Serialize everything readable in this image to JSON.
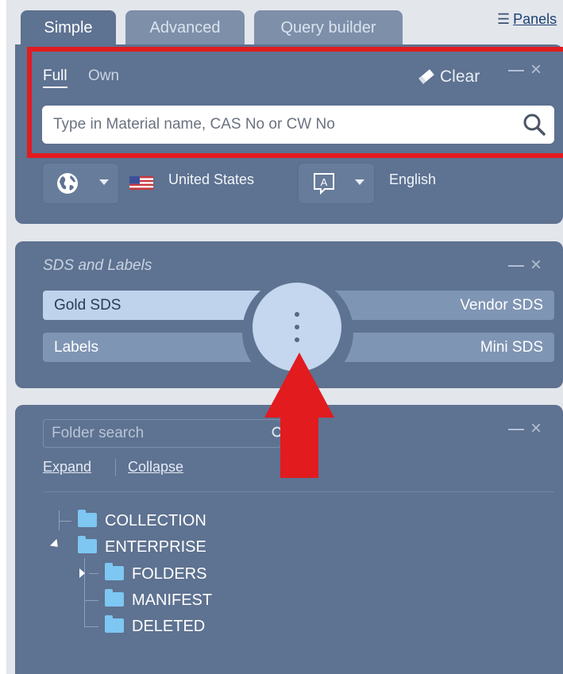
{
  "tabs": [
    {
      "label": "Simple",
      "active": true
    },
    {
      "label": "Advanced",
      "active": false
    },
    {
      "label": "Query builder",
      "active": false
    }
  ],
  "panels_link": {
    "label": "Panels"
  },
  "search_panel": {
    "modes": [
      {
        "label": "Full",
        "active": true
      },
      {
        "label": "Own",
        "active": false
      }
    ],
    "clear_label": "Clear",
    "search": {
      "placeholder": "Type in Material name, CAS No or CW No",
      "value": ""
    },
    "region": {
      "icon": "globe-icon",
      "country": "United States",
      "flag": "us-flag-icon"
    },
    "language": {
      "icon": "language-icon",
      "label": "English"
    }
  },
  "sds_panel": {
    "title": "SDS and Labels",
    "buttons": {
      "gold": "Gold SDS",
      "vendor": "Vendor SDS",
      "labels": "Labels",
      "mini": "Mini SDS"
    },
    "hub_icon": "more-vertical-icon"
  },
  "folder_panel": {
    "search_placeholder": "Folder search",
    "expand_label": "Expand",
    "collapse_label": "Collapse",
    "tree": [
      {
        "label": "COLLECTION",
        "level": 0
      },
      {
        "label": "ENTERPRISE",
        "level": 0,
        "expanded": true
      },
      {
        "label": "FOLDERS",
        "level": 1,
        "expanded": false
      },
      {
        "label": "MANIFEST",
        "level": 1
      },
      {
        "label": "DELETED",
        "level": 1
      }
    ]
  },
  "colors": {
    "panel": "#5e7291",
    "highlight": "#e21b1f",
    "gold_button": "#bfd3ec",
    "folder": "#7dc7f2"
  }
}
